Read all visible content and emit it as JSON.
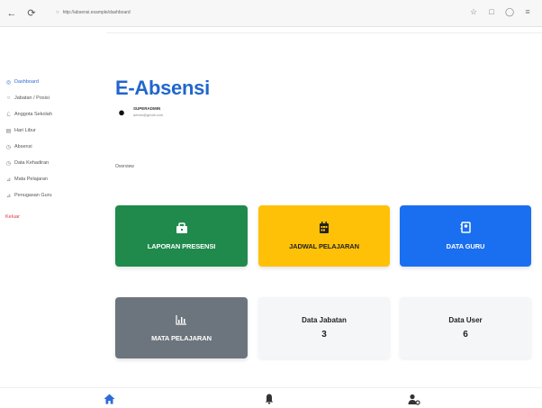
{
  "browser": {
    "back_icon": "arrow-left-icon",
    "reload_icon": "reload-icon",
    "url": "http://absensi.example/dashboard"
  },
  "sidebar": {
    "items": [
      {
        "label": "Dashboard",
        "icon": "dashboard-icon",
        "active": true
      },
      {
        "label": "Jabatan / Posisi",
        "icon": "person-icon"
      },
      {
        "label": "Anggota Sekolah",
        "icon": "people-icon"
      },
      {
        "label": "Hari Libur",
        "icon": "calendar-icon"
      },
      {
        "label": "Absensi",
        "icon": "clock-icon"
      },
      {
        "label": "Data Kehadiran",
        "icon": "clock-icon"
      },
      {
        "label": "Mata Pelajaran",
        "icon": "book-icon"
      },
      {
        "label": "Penugasan Guru",
        "icon": "people-icon"
      }
    ],
    "logout_label": "Keluar"
  },
  "main": {
    "title": "E-Absensi",
    "user": {
      "name": "SUPERADMIN",
      "email": "admin@gmail.com"
    },
    "overview_label": "Overview",
    "cards": {
      "laporan": {
        "label": "LAPORAN PRESENSI",
        "icon": "bag-icon",
        "color": "#1f8a4c"
      },
      "jadwal": {
        "label": "JADWAL PELAJARAN",
        "icon": "calendar-icon",
        "color": "#ffc107"
      },
      "guru": {
        "label": "DATA GURU",
        "icon": "user-card-icon",
        "color": "#1a6ff0"
      },
      "mapel": {
        "label": "MATA PELAJARAN",
        "icon": "chart-icon",
        "color": "#6c757d"
      },
      "jabatan": {
        "title": "Data Jabatan",
        "value": "3"
      },
      "user": {
        "title": "Data User",
        "value": "6"
      }
    }
  },
  "bottom_nav": {
    "items": [
      {
        "icon": "home-icon",
        "color": "#2d6bd6"
      },
      {
        "icon": "bell-icon",
        "color": "#333333"
      },
      {
        "icon": "user-settings-icon",
        "color": "#333333"
      }
    ]
  }
}
